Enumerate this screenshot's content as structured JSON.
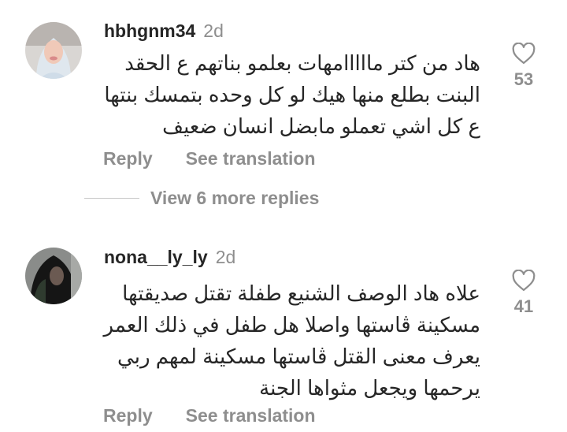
{
  "comments": [
    {
      "username": "hbhgnm34",
      "time": "2d",
      "text_lines": [
        "هاد من كتر مااااامهات بعلمو بناتهم ع الحقد",
        "البنت بطلع منها هيك لو كل وحده بتمسك بنتها",
        "ع كل اشي تعملو مابضل انسان ضعيف"
      ],
      "likes": "53",
      "reply_label": "Reply",
      "translate_label": "See translation"
    },
    {
      "username": "nona__ly_ly",
      "time": "2d",
      "text_lines": [
        "علاه هاد الوصف الشنيع طفلة تقتل صديقتها",
        "مسكينة ڨاستها واصلا هل طفل في ذلك العمر",
        "يعرف معنى القتل ڨاستها مسكينة لمهم ربي",
        "يرحمها ويجعل مثواها الجنة"
      ],
      "likes": "41",
      "reply_label": "Reply",
      "translate_label": "See translation"
    }
  ],
  "view_more_replies": "View 6 more replies",
  "colors": {
    "text": "#262626",
    "secondary": "#8e8e8e",
    "divider": "#c7c7c7"
  },
  "icons": {
    "like": "heart-outline-icon"
  }
}
